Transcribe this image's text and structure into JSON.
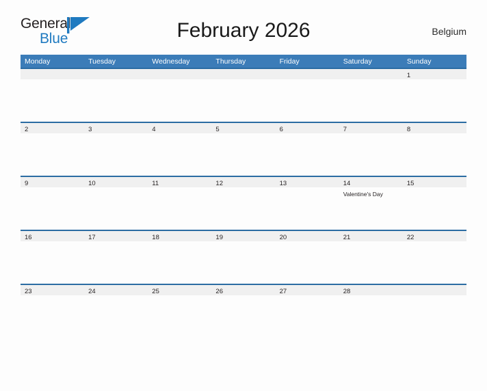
{
  "brand": {
    "name_part1": "General",
    "name_part2": "Blue",
    "flag_icon": "flag-triangle-icon",
    "color_dark": "#231f20",
    "color_blue": "#1f7ac0"
  },
  "header": {
    "title": "February 2026",
    "country": "Belgium"
  },
  "colors": {
    "header_blue": "#3b7cb8",
    "separator_blue": "#2b6ca3",
    "band_gray": "#f0f0f0",
    "page_background": "#fdfdfd",
    "text_dark": "#231f20"
  },
  "calendar": {
    "month": "February",
    "year": "2026",
    "weekday_headers": [
      "Monday",
      "Tuesday",
      "Wednesday",
      "Thursday",
      "Friday",
      "Saturday",
      "Sunday"
    ],
    "weeks": [
      [
        {
          "day": "",
          "event": ""
        },
        {
          "day": "",
          "event": ""
        },
        {
          "day": "",
          "event": ""
        },
        {
          "day": "",
          "event": ""
        },
        {
          "day": "",
          "event": ""
        },
        {
          "day": "",
          "event": ""
        },
        {
          "day": "1",
          "event": ""
        }
      ],
      [
        {
          "day": "2",
          "event": ""
        },
        {
          "day": "3",
          "event": ""
        },
        {
          "day": "4",
          "event": ""
        },
        {
          "day": "5",
          "event": ""
        },
        {
          "day": "6",
          "event": ""
        },
        {
          "day": "7",
          "event": ""
        },
        {
          "day": "8",
          "event": ""
        }
      ],
      [
        {
          "day": "9",
          "event": ""
        },
        {
          "day": "10",
          "event": ""
        },
        {
          "day": "11",
          "event": ""
        },
        {
          "day": "12",
          "event": ""
        },
        {
          "day": "13",
          "event": ""
        },
        {
          "day": "14",
          "event": "Valentine's Day"
        },
        {
          "day": "15",
          "event": ""
        }
      ],
      [
        {
          "day": "16",
          "event": ""
        },
        {
          "day": "17",
          "event": ""
        },
        {
          "day": "18",
          "event": ""
        },
        {
          "day": "19",
          "event": ""
        },
        {
          "day": "20",
          "event": ""
        },
        {
          "day": "21",
          "event": ""
        },
        {
          "day": "22",
          "event": ""
        }
      ],
      [
        {
          "day": "23",
          "event": ""
        },
        {
          "day": "24",
          "event": ""
        },
        {
          "day": "25",
          "event": ""
        },
        {
          "day": "26",
          "event": ""
        },
        {
          "day": "27",
          "event": ""
        },
        {
          "day": "28",
          "event": ""
        },
        {
          "day": "",
          "event": ""
        }
      ]
    ]
  }
}
